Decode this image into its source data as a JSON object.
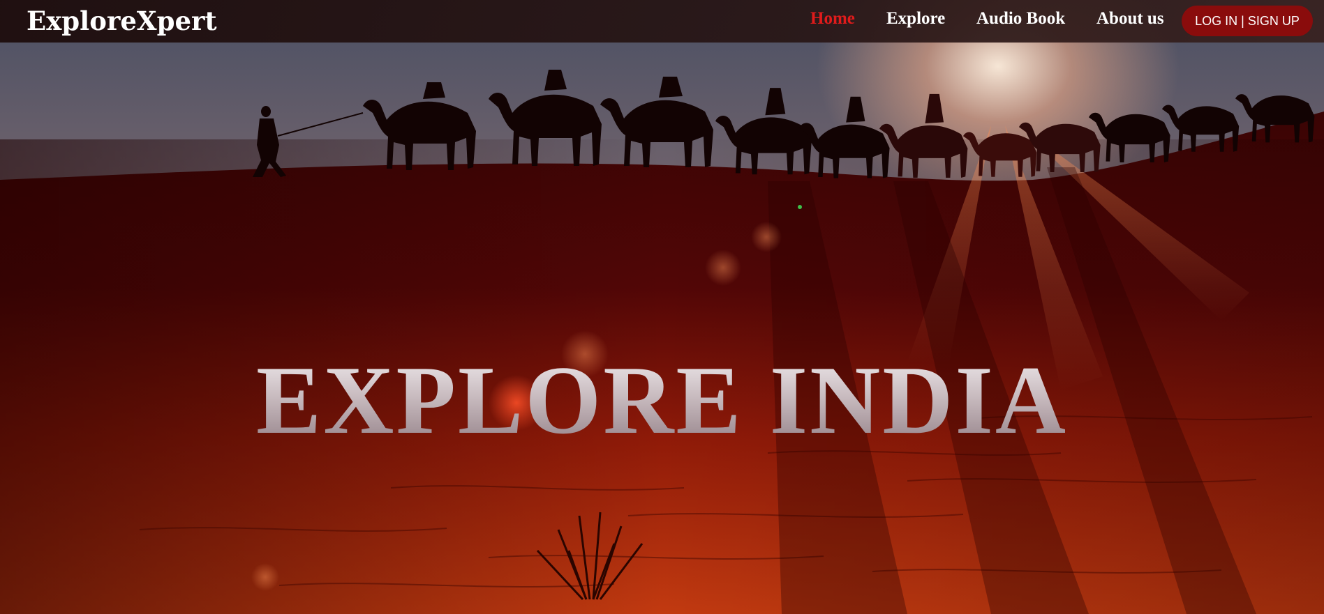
{
  "navbar": {
    "brand": "ExploreXpert",
    "links": [
      {
        "label": "Home",
        "active": true
      },
      {
        "label": "Explore",
        "active": false
      },
      {
        "label": "Audio Book",
        "active": false
      },
      {
        "label": "About us",
        "active": false
      }
    ],
    "login_label": "LOG IN | SIGN UP"
  },
  "hero": {
    "headline": "EXPLORE INDIA",
    "background": "desert-camel-caravan-sunset-image"
  },
  "colors": {
    "active_link": "#e01b1b",
    "login_button": "#8a0c0c",
    "navbar_bg": "#1e0e0e",
    "sand": "#b8300f"
  }
}
